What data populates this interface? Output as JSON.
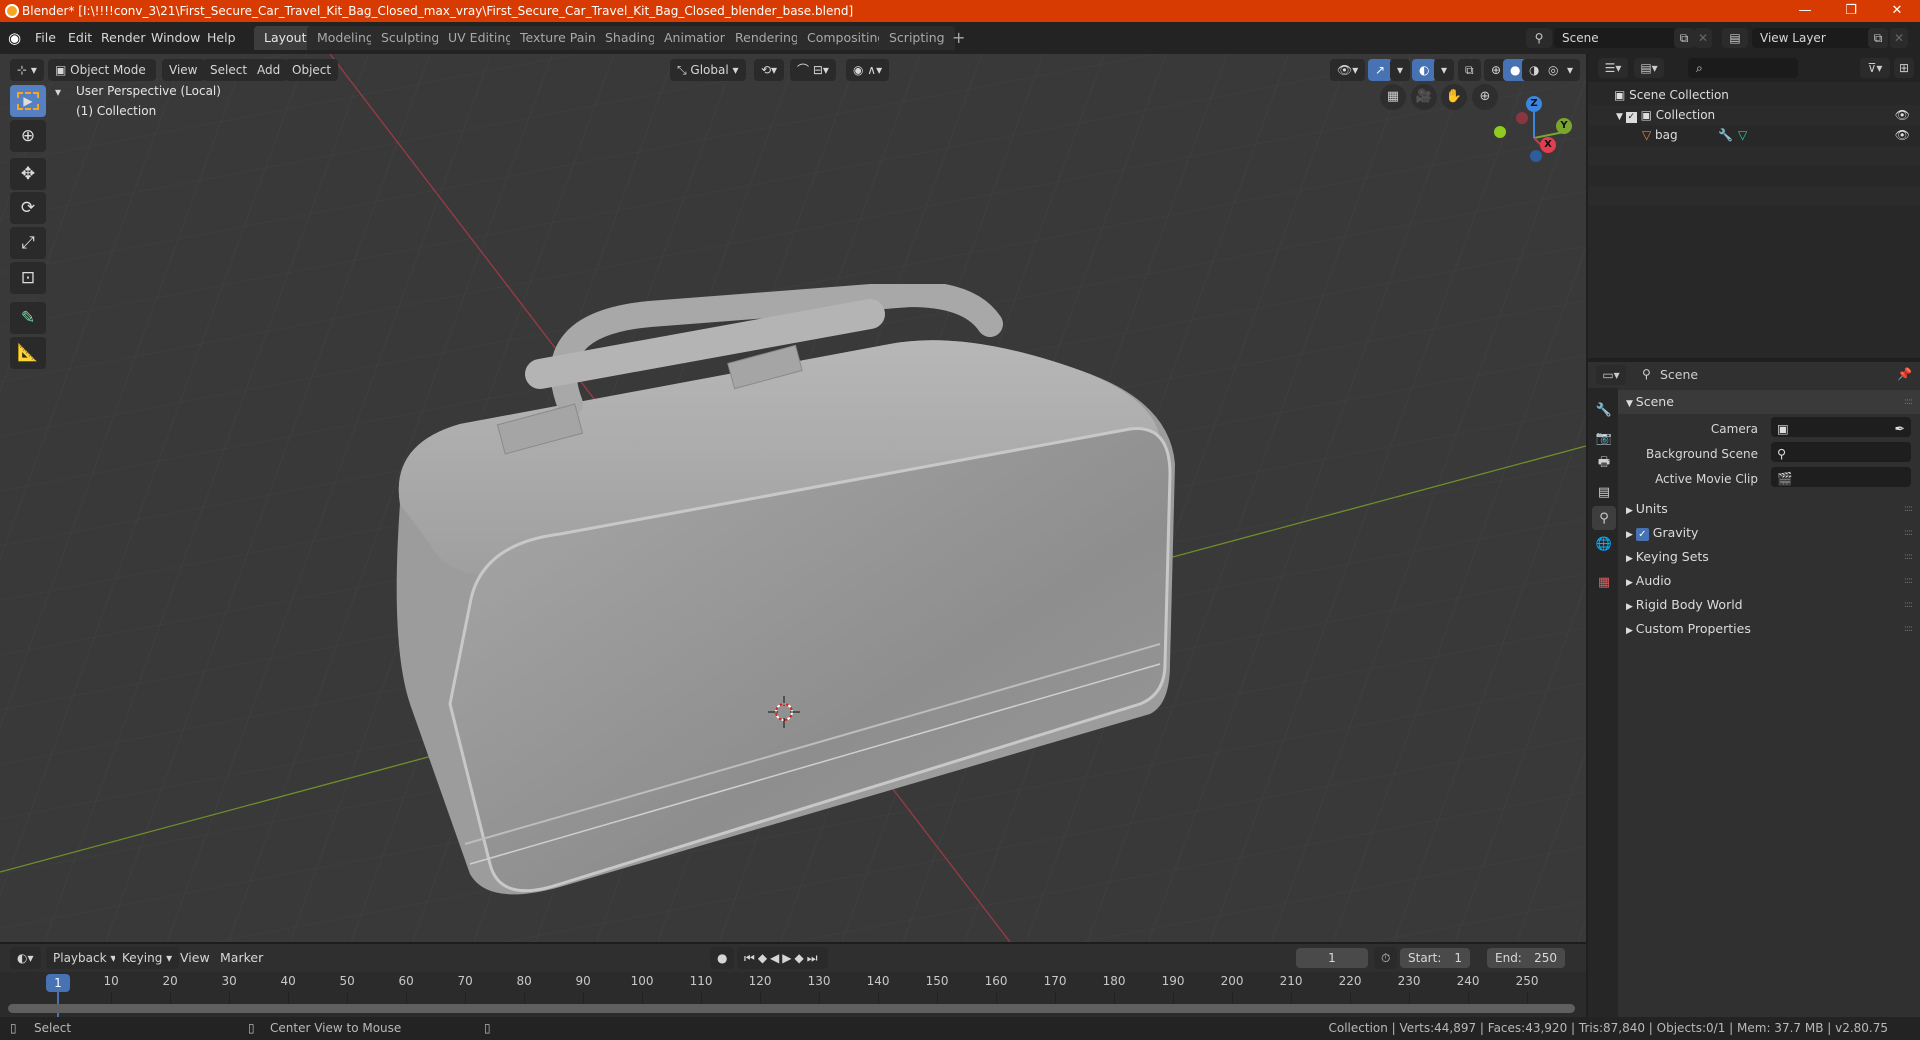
{
  "window": {
    "title": "Blender* [I:\\!!!!conv_3\\21\\First_Secure_Car_Travel_Kit_Bag_Closed_max_vray\\First_Secure_Car_Travel_Kit_Bag_Closed_blender_base.blend]",
    "controls": {
      "minimize": "—",
      "maximize": "❐",
      "close": "✕"
    }
  },
  "menubar": {
    "items": [
      "File",
      "Edit",
      "Render",
      "Window",
      "Help"
    ]
  },
  "workspaces": {
    "tabs": [
      "Layout",
      "Modeling",
      "Sculpting",
      "UV Editing",
      "Texture Paint",
      "Shading",
      "Animation",
      "Rendering",
      "Compositing",
      "Scripting"
    ],
    "active": "Layout",
    "add_label": "+"
  },
  "scene_selector": {
    "value": "Scene"
  },
  "view_layer_selector": {
    "value": "View Layer"
  },
  "viewport_header": {
    "mode": "Object Mode",
    "menus": [
      "View",
      "Select",
      "Add",
      "Object"
    ],
    "transform_orientation": "Global"
  },
  "viewport": {
    "perspective_label": "User Perspective (Local)",
    "collection_label": "(1) Collection",
    "gizmo_axes": {
      "x": "X",
      "y": "Y",
      "z": "Z"
    },
    "colors": {
      "x_axis": "#c9384a",
      "y_axis": "#7ba52e",
      "z_axis": "#3b86e0",
      "bg": "#393939",
      "mesh": "#9a9a9a"
    }
  },
  "tools": [
    {
      "name": "select-box",
      "icon": "select-box-icon",
      "active": true
    },
    {
      "name": "cursor",
      "icon": "cursor-icon",
      "active": false
    },
    {
      "name": "move",
      "icon": "move-icon",
      "active": false
    },
    {
      "name": "rotate",
      "icon": "rotate-icon",
      "active": false
    },
    {
      "name": "scale",
      "icon": "scale-icon",
      "active": false
    },
    {
      "name": "transform",
      "icon": "transform-icon",
      "active": false
    },
    {
      "name": "annotate",
      "icon": "annotate-icon",
      "active": false
    },
    {
      "name": "measure",
      "icon": "measure-icon",
      "active": false
    }
  ],
  "outliner": {
    "root": "Scene Collection",
    "items": [
      {
        "label": "Collection",
        "checked": true,
        "visible": true
      },
      {
        "label": "bag",
        "visible": true
      }
    ]
  },
  "properties": {
    "context": "Scene",
    "panel_title": "Scene",
    "fields": [
      {
        "label": "Camera",
        "value": ""
      },
      {
        "label": "Background Scene",
        "value": ""
      },
      {
        "label": "Active Movie Clip",
        "value": ""
      }
    ],
    "sections": [
      {
        "label": "Units"
      },
      {
        "label": "Gravity",
        "checked": true
      },
      {
        "label": "Keying Sets"
      },
      {
        "label": "Audio"
      },
      {
        "label": "Rigid Body World"
      },
      {
        "label": "Custom Properties"
      }
    ]
  },
  "timeline": {
    "menus": [
      "Playback",
      "Keying",
      "View",
      "Marker"
    ],
    "current_frame": "1",
    "start_label": "Start:",
    "start": "1",
    "end_label": "End:",
    "end": "250",
    "ticks": [
      "10",
      "20",
      "30",
      "40",
      "50",
      "60",
      "70",
      "80",
      "90",
      "100",
      "110",
      "120",
      "130",
      "140",
      "150",
      "160",
      "170",
      "180",
      "190",
      "200",
      "210",
      "220",
      "230",
      "240",
      "250"
    ],
    "playhead": "1"
  },
  "statusbar": {
    "left_action": "Select",
    "middle_action": "Center View to Mouse",
    "stats": "Collection | Verts:44,897 | Faces:43,920 | Tris:87,840 | Objects:0/1 | Mem: 37.7 MB | v2.80.75"
  }
}
